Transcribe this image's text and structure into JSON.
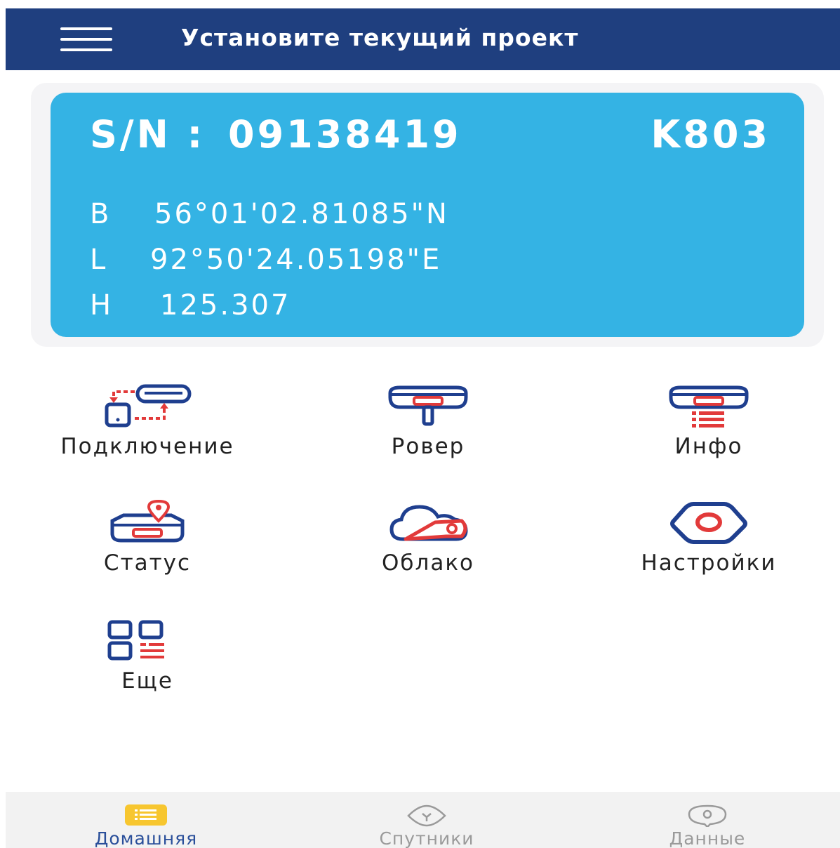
{
  "header": {
    "title": "Установите текущий проект",
    "menu_icon": "hamburger-menu-icon"
  },
  "device": {
    "sn_label": "S/N :",
    "serial": "09138419",
    "model": "K803",
    "b_label": "B",
    "b_value": "56°01'02.81085\"N",
    "l_label": "L",
    "l_value": "92°50'24.05198\"E",
    "h_label": "H",
    "h_value": "125.307"
  },
  "functions": [
    {
      "label": "Подключение",
      "icon": "connection-icon"
    },
    {
      "label": "Ровер",
      "icon": "rover-icon"
    },
    {
      "label": "Инфо",
      "icon": "info-icon"
    },
    {
      "label": "Статус",
      "icon": "status-icon"
    },
    {
      "label": "Облако",
      "icon": "cloud-icon"
    },
    {
      "label": "Настройки",
      "icon": "settings-icon"
    },
    {
      "label": "Еще",
      "icon": "more-icon"
    }
  ],
  "bottom_nav": [
    {
      "label": "Домашняя",
      "icon": "home-icon",
      "active": true
    },
    {
      "label": "Спутники",
      "icon": "satellites-icon",
      "active": false
    },
    {
      "label": "Данные",
      "icon": "data-icon",
      "active": false
    }
  ],
  "colors": {
    "header_bg": "#1f3f7f",
    "card_bg": "#34b3e4",
    "icon_blue": "#1f3f8f",
    "icon_red": "#e23a3a",
    "nav_active": "#2a4f9a",
    "nav_active_icon": "#f7c62f",
    "nav_inactive": "#9a9a9a"
  }
}
